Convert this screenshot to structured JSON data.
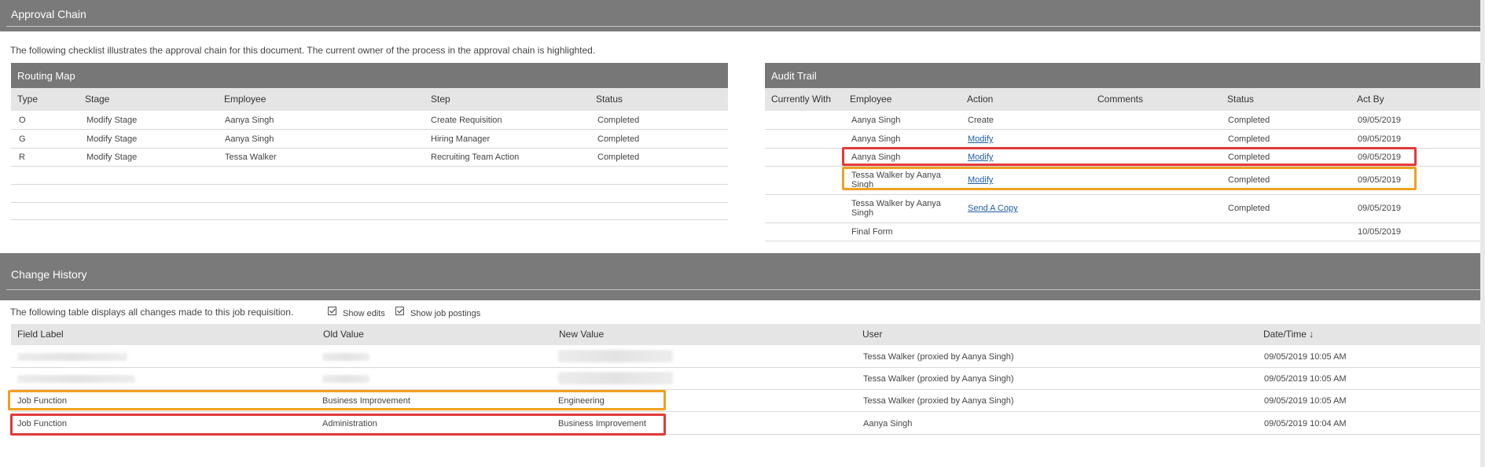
{
  "approval_chain": {
    "title": "Approval Chain",
    "intro": "The following checklist illustrates the approval chain for this document. The current owner of the process in the approval chain is highlighted."
  },
  "routing_map": {
    "title": "Routing Map",
    "columns": [
      "Type",
      "Stage",
      "Employee",
      "Step",
      "Status"
    ],
    "rows": [
      {
        "type": "O",
        "stage": "Modify Stage",
        "employee": "Aanya Singh",
        "step": "Create Requisition",
        "status": "Completed"
      },
      {
        "type": "G",
        "stage": "Modify Stage",
        "employee": "Aanya Singh",
        "step": "Hiring Manager",
        "status": "Completed"
      },
      {
        "type": "R",
        "stage": "Modify Stage",
        "employee": "Tessa Walker",
        "step": "Recruiting Team Action",
        "status": "Completed"
      }
    ]
  },
  "audit_trail": {
    "title": "Audit Trail",
    "columns": [
      "Currently With",
      "Employee",
      "Action",
      "Comments",
      "Status",
      "Act By"
    ],
    "rows": [
      {
        "employee": "Aanya Singh",
        "action": "Create",
        "action_link": false,
        "status": "Completed",
        "act_by": "09/05/2019"
      },
      {
        "employee": "Aanya Singh",
        "action": "Modify",
        "action_link": true,
        "status": "Completed",
        "act_by": "09/05/2019"
      },
      {
        "employee": "Aanya Singh",
        "action": "Modify",
        "action_link": true,
        "status": "Completed",
        "act_by": "09/05/2019"
      },
      {
        "employee": "Tessa Walker by Aanya Singh",
        "action": "Modify",
        "action_link": true,
        "status": "Completed",
        "act_by": "09/05/2019"
      },
      {
        "employee": "Tessa Walker by Aanya Singh",
        "action": "Send A Copy",
        "action_link": true,
        "status": "Completed",
        "act_by": "09/05/2019"
      },
      {
        "employee": "Final Form",
        "action": "",
        "action_link": false,
        "status": "",
        "act_by": "10/05/2019"
      }
    ]
  },
  "change_history": {
    "title": "Change History",
    "intro": "The following table displays all changes made to this job requisition.",
    "show_edits_label": "Show edits",
    "show_postings_label": "Show job postings",
    "columns": [
      "Field Label",
      "Old Value",
      "New Value",
      "User",
      "Date/Time"
    ],
    "sort_indicator": "↓",
    "rows": [
      {
        "field": "",
        "old": "",
        "new": "",
        "user": "Tessa Walker (proxied by Aanya Singh)",
        "datetime": "09/05/2019 10:05 AM"
      },
      {
        "field": "",
        "old": "",
        "new": "",
        "user": "Tessa Walker (proxied by Aanya Singh)",
        "datetime": "09/05/2019 10:05 AM"
      },
      {
        "field": "Job Function",
        "old": "Business Improvement",
        "new": "Engineering",
        "user": "Tessa Walker (proxied by Aanya Singh)",
        "datetime": "09/05/2019 10:05 AM"
      },
      {
        "field": "Job Function",
        "old": "Administration",
        "new": "Business Improvement",
        "user": "Aanya Singh",
        "datetime": "09/05/2019 10:04 AM"
      }
    ]
  },
  "colors": {
    "band": "#7a7a7a",
    "panel_header": "#777777",
    "col_header": "#e5e5e5",
    "highlight_red": "#e23a3a",
    "highlight_orange": "#f0a020",
    "link": "#1f5ea8"
  }
}
